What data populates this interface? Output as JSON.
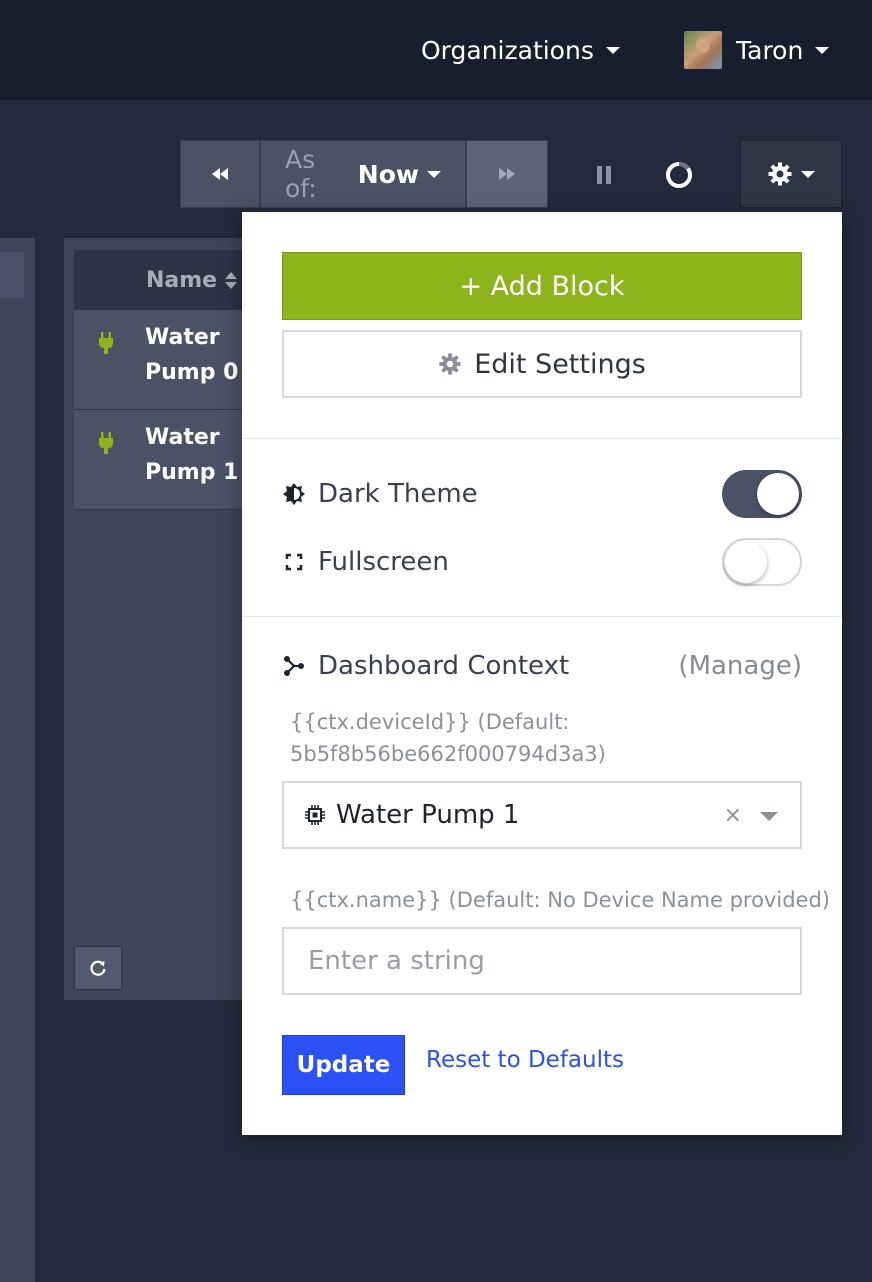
{
  "header": {
    "organizations_label": "Organizations",
    "user_name": "Taron"
  },
  "toolbar": {
    "asof_prefix": "As of:",
    "asof_value": "Now"
  },
  "table": {
    "column_name": "Name",
    "rows": [
      {
        "line1": "Water",
        "line2": "Pump 0"
      },
      {
        "line1": "Water",
        "line2": "Pump 1"
      }
    ]
  },
  "menu": {
    "add_block_label": "+ Add Block",
    "edit_settings_label": "Edit Settings",
    "dark_theme_label": "Dark Theme",
    "dark_theme_on": true,
    "fullscreen_label": "Fullscreen",
    "fullscreen_on": false,
    "context_label": "Dashboard Context",
    "manage_label": "(Manage)",
    "device_hint_line1": "{{ctx.deviceId}} (Default:",
    "device_hint_line2": "5b5f8b56be662f000794d3a3)",
    "device_selected": "Water Pump 1",
    "clear_symbol": "×",
    "name_hint": "{{ctx.name}} (Default: No Device Name provided)",
    "name_placeholder": "Enter a string",
    "name_value": "",
    "update_label": "Update",
    "reset_label": "Reset to Defaults"
  },
  "colors": {
    "accent_green": "#8db41a",
    "accent_blue": "#2a50f6",
    "topbar": "#171e2d",
    "background": "#232a3b"
  },
  "icons": {
    "rewind": "rewind-icon",
    "fast_forward": "fast-forward-icon",
    "pause": "pause-icon",
    "loading": "loading-ring-icon",
    "settings": "gear-icon",
    "plug": "plug-icon",
    "refresh": "refresh-icon",
    "theme": "theme-icon",
    "fullscreen": "fullscreen-icon",
    "context": "share-nodes-icon",
    "device": "chip-icon"
  }
}
